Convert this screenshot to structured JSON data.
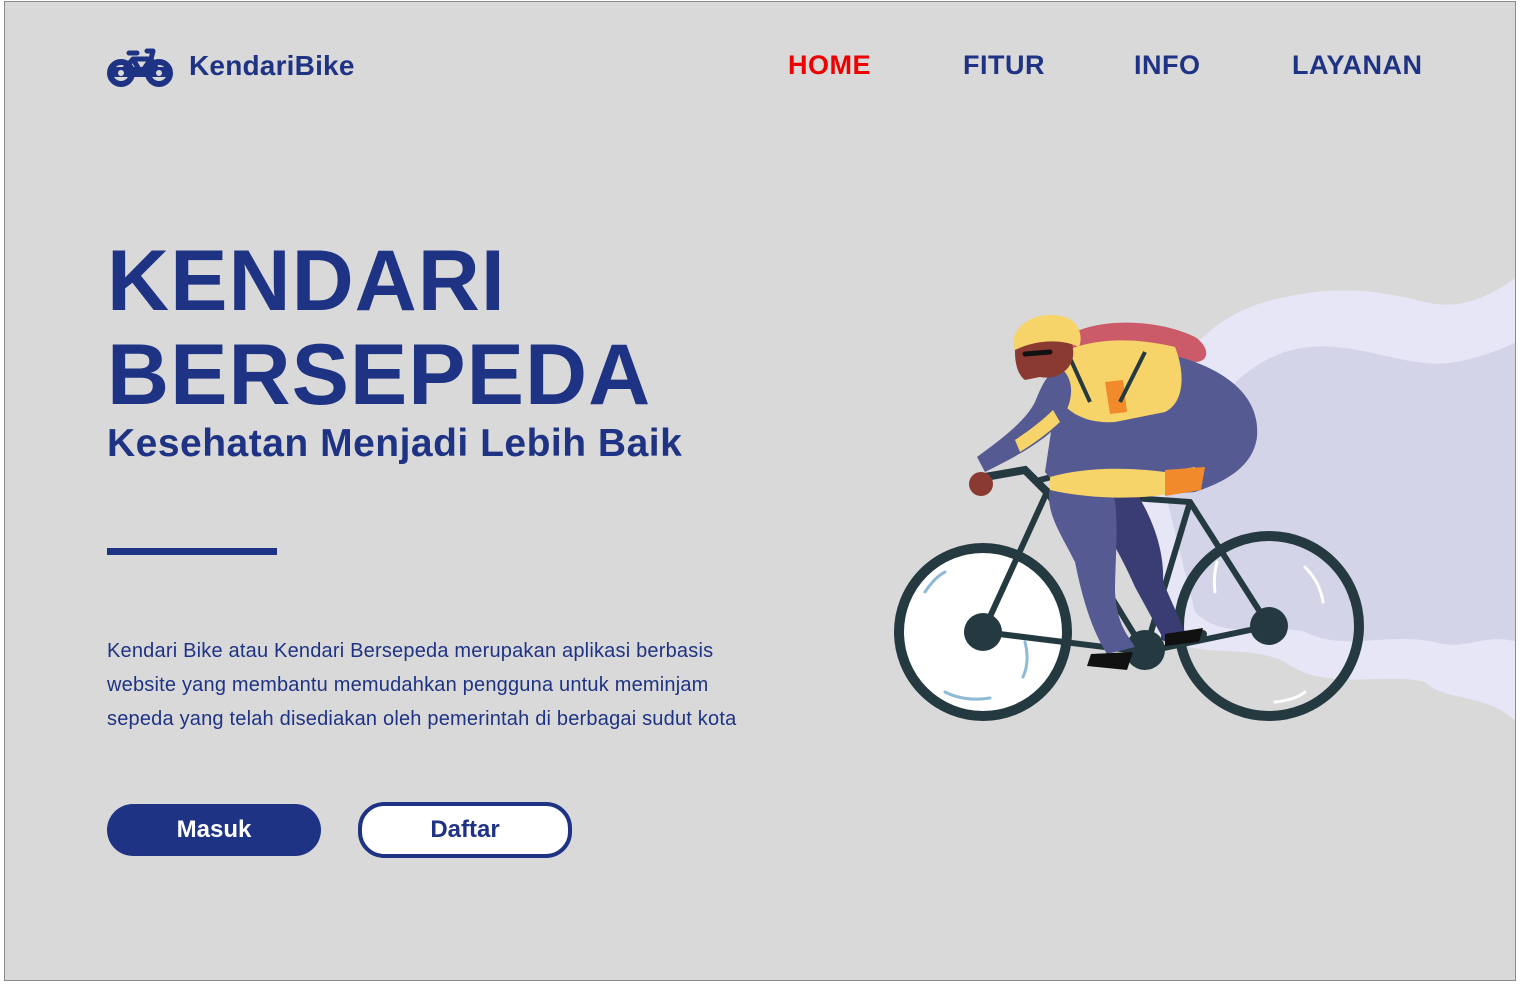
{
  "brand": {
    "name": "KendariBike",
    "logo_icon": "bicycle-icon"
  },
  "nav": {
    "items": [
      {
        "label": "HOME",
        "active": true
      },
      {
        "label": "FITUR",
        "active": false
      },
      {
        "label": "INFO",
        "active": false
      },
      {
        "label": "LAYANAN",
        "active": false
      }
    ]
  },
  "hero": {
    "title_line1": "KENDARI",
    "title_line2": "BERSEPEDA",
    "subtitle": "Kesehatan Menjadi Lebih Baik",
    "description_lines": [
      "Kendari Bike atau Kendari Bersepeda merupakan aplikasi berbasis",
      "website yang membantu memudahkan pengguna untuk meminjam",
      "sepeda yang telah disediakan oleh pemerintah di berbagai sudut kota"
    ],
    "buttons": {
      "masuk": "Masuk",
      "daftar": "Daftar"
    },
    "illustration": "cyclist-illustration"
  },
  "colors": {
    "primary": "#1f3384",
    "active_nav": "#ee0000",
    "background": "#d9d9d9",
    "accent_yellow": "#f7d46a",
    "accent_purple": "#565a93"
  }
}
